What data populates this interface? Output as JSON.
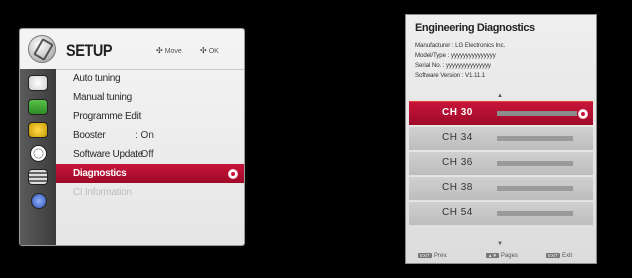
{
  "setup": {
    "title": "SETUP",
    "hint_move": "Move",
    "hint_ok": "OK",
    "hint_move_glyph": "✣",
    "hint_ok_glyph": "✣",
    "sidebar_icons": [
      "picture-icon",
      "tv-icon",
      "audio-icon",
      "time-icon",
      "option-icon",
      "globe-icon"
    ],
    "menu": [
      {
        "label": "Auto tuning",
        "value": ""
      },
      {
        "label": "Manual tuning",
        "value": ""
      },
      {
        "label": "Programme Edit",
        "value": ""
      },
      {
        "label": "Booster",
        "value": ": On"
      },
      {
        "label": "Software Update",
        "value": ": Off"
      },
      {
        "label": "Diagnostics",
        "value": ""
      },
      {
        "label": "CI Information",
        "value": ""
      }
    ],
    "selected_index": 5,
    "accent_color": "#c8143a"
  },
  "diagnostics": {
    "title": "Engineering Diagnostics",
    "manufacturer": "Manufacturer : LG Electronics Inc.",
    "model": "Model/Type : yyyyyyyyyyyyyyy",
    "serial": "Serial No. : yyyyyyyyyyyyyyy",
    "software": "Software Version : V1.11.1",
    "channels": [
      "CH 30",
      "CH 34",
      "CH 36",
      "CH 38",
      "CH 54"
    ],
    "selected_index": 0,
    "footer_prev": "Prev.",
    "footer_pages": "Pages",
    "footer_exit": "Exit",
    "footer_key_prev": "EXIT",
    "footer_key_exit": "EXIT",
    "footer_key_pages": "▲▼"
  }
}
